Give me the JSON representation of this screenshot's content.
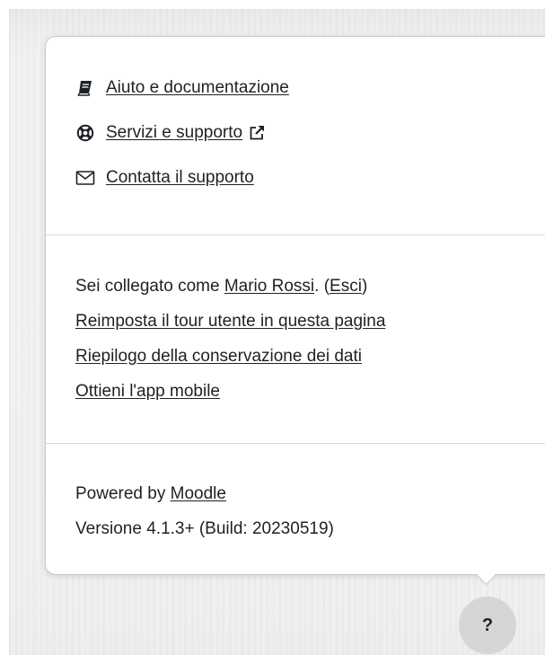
{
  "help_links": {
    "documentation": {
      "label": "Aiuto e documentazione",
      "icon": "book-icon"
    },
    "services": {
      "label": "Servizi e supporto",
      "icon": "life-ring-icon",
      "external_icon": "external-link-icon"
    },
    "contact": {
      "label": "Contatta il supporto",
      "icon": "envelope-icon"
    }
  },
  "user_info": {
    "logged_in_prefix": "Sei collegato come ",
    "user_name": "Mario Rossi",
    "separator": ". (",
    "logout_label": "Esci",
    "close_paren": ")",
    "reset_tour": "Reimposta il tour utente in questa pagina",
    "data_retention": "Riepilogo della conservazione dei dati",
    "mobile_app": "Ottieni l'app mobile"
  },
  "footer": {
    "powered_by_prefix": "Powered by ",
    "powered_by_link": "Moodle",
    "version": "Versione 4.1.3+ (Build: 20230519)"
  },
  "help_button": {
    "label": "?"
  }
}
